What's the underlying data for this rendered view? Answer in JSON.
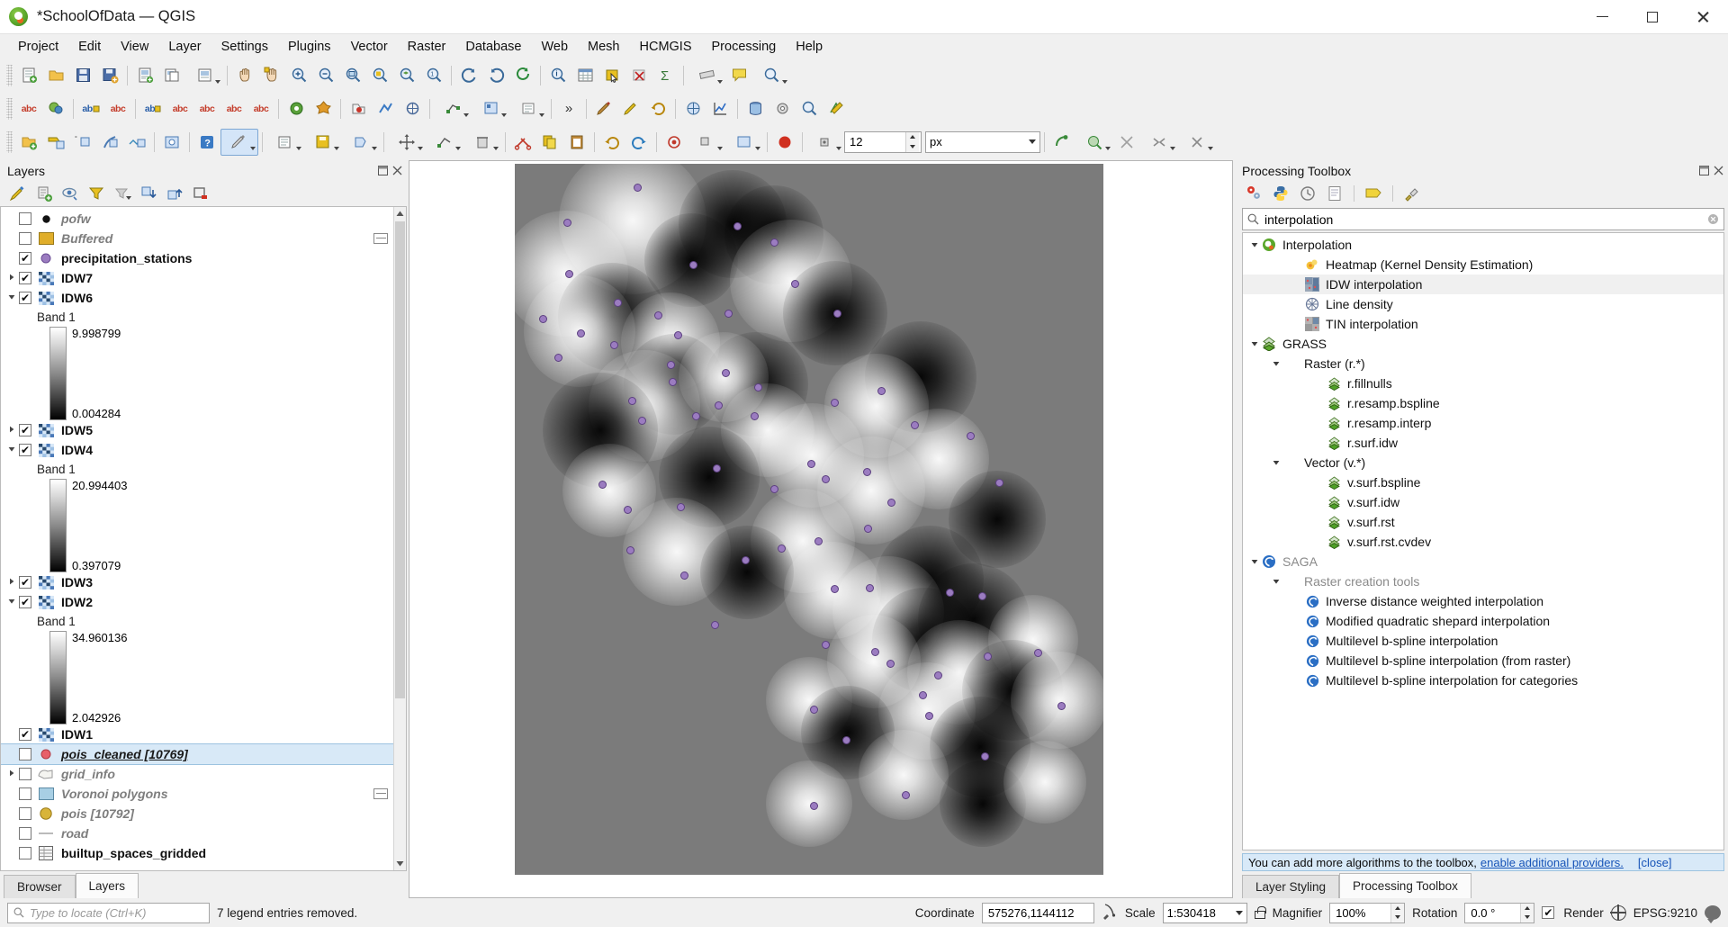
{
  "window": {
    "title": "*SchoolOfData — QGIS",
    "app_icon": "qgis-logo-icon",
    "minimize": "minimize-icon",
    "maximize": "maximize-icon",
    "close": "close-icon"
  },
  "menubar": {
    "items": [
      "Project",
      "Edit",
      "View",
      "Layer",
      "Settings",
      "Plugins",
      "Vector",
      "Raster",
      "Database",
      "Web",
      "Mesh",
      "HCMGIS",
      "Processing",
      "Help"
    ]
  },
  "toolbars": {
    "row1": [
      "new-project-icon",
      "open-project-icon",
      "save-project-icon",
      "save-as-icon",
      "new-print-layout-icon",
      "layout-manager-icon",
      "show-layouts-icon",
      "pan-map-icon",
      "pan-to-selection-icon",
      "zoom-in-icon",
      "zoom-out-icon",
      "zoom-full-icon",
      "zoom-selection-icon",
      "zoom-layer-icon",
      "zoom-native-icon",
      "zoom-last-icon",
      "zoom-next-icon",
      "refresh-icon",
      "identify-features-icon",
      "open-attribute-table-icon",
      "select-features-icon",
      "deselect-icon",
      "statistical-summary-icon",
      "measure-icon",
      "text-annotation-icon",
      "show-map-tips-icon",
      "bookmarks-icon"
    ],
    "row2": [
      "label-abc-icon",
      "style-manager-icon",
      "label-toggle-icon",
      "label-red-icon",
      "label-1-icon",
      "label-2-icon",
      "label-3-icon",
      "label-4-icon",
      "color-picker-icon",
      "temporal-controller-icon",
      "warning-icon",
      "add-feature-point-icon",
      "add-feature-line-icon",
      "add-feature-poly-icon",
      "vertex-tool-icon",
      "node-tool-icon",
      "modify-attributes-icon",
      "overflow-icon",
      "digitize-shape-icon",
      "trace-icon",
      "undo-edit-icon",
      "georeferencer-icon",
      "plot-icon",
      "db-manager-icon",
      "processing-icon",
      "python-console-icon",
      "plugin-manager-icon"
    ],
    "row3": [
      "new-shapefile-icon",
      "new-geopackage-icon",
      "new-spatialite-icon",
      "new-memory-layer-icon",
      "new-mesh-layer-icon",
      "new-gpx-icon",
      "help-contents-icon",
      "current-edits-icon",
      "toggle-editing-icon",
      "save-layer-edits-icon",
      "add-polygon-icon",
      "move-feature-icon",
      "vertex-tool-all-icon",
      "delete-selected-icon",
      "cut-features-icon",
      "copy-features-icon",
      "paste-features-icon",
      "undo-icon",
      "redo-icon",
      "rotate-point-symbols-icon",
      "offset-curve-icon",
      "reshape-features-icon",
      "split-features-icon",
      "merge-features-icon",
      "simplify-feature-icon",
      "add-ring-icon",
      "add-part-icon",
      "fill-ring-icon",
      "delete-ring-icon",
      "delete-part-icon",
      "rotate-feature-icon",
      "scale-feature-icon"
    ],
    "size_value": "12",
    "unit_value": "px"
  },
  "layers_panel": {
    "title": "Layers",
    "panel_buttons": [
      "float-panel-icon",
      "close-panel-icon"
    ],
    "toolbar_icons": [
      "open-layer-styling-icon",
      "add-group-icon",
      "manage-map-themes-icon",
      "filter-legend-icon",
      "filter-legend-expression-icon",
      "expand-all-icon",
      "collapse-all-icon",
      "remove-layer-icon"
    ],
    "items": [
      {
        "indent": 0,
        "expander": "",
        "checked": false,
        "symbol": "point-black",
        "label": "pofw",
        "style": "dim",
        "extra": ""
      },
      {
        "indent": 0,
        "expander": "",
        "checked": false,
        "symbol": "fill-gold",
        "label": "Buffered",
        "style": "dim",
        "extra": "edit"
      },
      {
        "indent": 0,
        "expander": "",
        "checked": true,
        "symbol": "point-purple",
        "label": "precipitation_stations",
        "style": "bold",
        "extra": ""
      },
      {
        "indent": 0,
        "expander": "collapsed",
        "checked": true,
        "symbol": "raster",
        "label": "IDW7",
        "style": "bold",
        "extra": ""
      },
      {
        "indent": 0,
        "expander": "expanded",
        "checked": true,
        "symbol": "raster",
        "label": "IDW6",
        "style": "bold",
        "extra": ""
      },
      {
        "type": "band",
        "label": "Band 1",
        "max": "9.998799",
        "min": "0.004284"
      },
      {
        "indent": 0,
        "expander": "collapsed",
        "checked": true,
        "symbol": "raster",
        "label": "IDW5",
        "style": "bold",
        "extra": ""
      },
      {
        "indent": 0,
        "expander": "expanded",
        "checked": true,
        "symbol": "raster",
        "label": "IDW4",
        "style": "bold",
        "extra": ""
      },
      {
        "type": "band",
        "label": "Band 1",
        "max": "20.994403",
        "min": "0.397079"
      },
      {
        "indent": 0,
        "expander": "collapsed",
        "checked": true,
        "symbol": "raster",
        "label": "IDW3",
        "style": "bold",
        "extra": ""
      },
      {
        "indent": 0,
        "expander": "expanded",
        "checked": true,
        "symbol": "raster",
        "label": "IDW2",
        "style": "bold",
        "extra": ""
      },
      {
        "type": "band",
        "label": "Band 1",
        "max": "34.960136",
        "min": "2.042926"
      },
      {
        "indent": 0,
        "expander": "",
        "checked": true,
        "symbol": "raster",
        "label": "IDW1",
        "style": "bold",
        "extra": ""
      },
      {
        "indent": 0,
        "expander": "",
        "checked": false,
        "symbol": "point-red",
        "label": "pois_cleaned [10769]",
        "style": "selected",
        "extra": ""
      },
      {
        "indent": 0,
        "expander": "collapsed",
        "checked": false,
        "symbol": "polygon-outline",
        "label": "grid_info",
        "style": "dim",
        "extra": ""
      },
      {
        "indent": 0,
        "expander": "",
        "checked": false,
        "symbol": "fill-lightblue",
        "label": "Voronoi polygons",
        "style": "dim",
        "extra": "edit"
      },
      {
        "indent": 0,
        "expander": "",
        "checked": false,
        "symbol": "point-gold",
        "label": "pois [10792]",
        "style": "dim",
        "extra": ""
      },
      {
        "indent": 0,
        "expander": "",
        "checked": false,
        "symbol": "line-grey",
        "label": "road",
        "style": "dim",
        "extra": ""
      },
      {
        "indent": 0,
        "expander": "",
        "checked": false,
        "symbol": "table",
        "label": "builtup_spaces_gridded",
        "style": "bold-plain",
        "extra": ""
      }
    ],
    "tabs": [
      {
        "label": "Browser",
        "active": false
      },
      {
        "label": "Layers",
        "active": true
      }
    ]
  },
  "processing_panel": {
    "title": "Processing Toolbox",
    "panel_buttons": [
      "float-panel-icon",
      "close-panel-icon"
    ],
    "toolbar_icons": [
      "run-model-icon",
      "python-script-icon",
      "history-icon",
      "results-viewer-icon",
      "models-icon",
      "options-icon"
    ],
    "search": {
      "value": "interpolation",
      "icon": "search-icon"
    },
    "tree": [
      {
        "depth": 0,
        "expander": "expanded",
        "icon": "qgis-provider-icon",
        "label": "Interpolation",
        "grey": false
      },
      {
        "depth": 2,
        "expander": "none",
        "icon": "heatmap-icon",
        "label": "Heatmap (Kernel Density Estimation)",
        "grey": false
      },
      {
        "depth": 2,
        "expander": "none",
        "icon": "idw-icon",
        "label": "IDW interpolation",
        "grey": false,
        "selected": true
      },
      {
        "depth": 2,
        "expander": "none",
        "icon": "linedensity-icon",
        "label": "Line density",
        "grey": false
      },
      {
        "depth": 2,
        "expander": "none",
        "icon": "tin-icon",
        "label": "TIN interpolation",
        "grey": false
      },
      {
        "depth": 0,
        "expander": "expanded",
        "icon": "grass-icon",
        "label": "GRASS",
        "grey": false
      },
      {
        "depth": 1,
        "expander": "expanded",
        "icon": "none",
        "label": "Raster (r.*)",
        "grey": false
      },
      {
        "depth": 3,
        "expander": "none",
        "icon": "grass-small-icon",
        "label": "r.fillnulls",
        "grey": false
      },
      {
        "depth": 3,
        "expander": "none",
        "icon": "grass-small-icon",
        "label": "r.resamp.bspline",
        "grey": false
      },
      {
        "depth": 3,
        "expander": "none",
        "icon": "grass-small-icon",
        "label": "r.resamp.interp",
        "grey": false
      },
      {
        "depth": 3,
        "expander": "none",
        "icon": "grass-small-icon",
        "label": "r.surf.idw",
        "grey": false
      },
      {
        "depth": 1,
        "expander": "expanded",
        "icon": "none",
        "label": "Vector (v.*)",
        "grey": false
      },
      {
        "depth": 3,
        "expander": "none",
        "icon": "grass-small-icon",
        "label": "v.surf.bspline",
        "grey": false
      },
      {
        "depth": 3,
        "expander": "none",
        "icon": "grass-small-icon",
        "label": "v.surf.idw",
        "grey": false
      },
      {
        "depth": 3,
        "expander": "none",
        "icon": "grass-small-icon",
        "label": "v.surf.rst",
        "grey": false
      },
      {
        "depth": 3,
        "expander": "none",
        "icon": "grass-small-icon",
        "label": "v.surf.rst.cvdev",
        "grey": false
      },
      {
        "depth": 0,
        "expander": "expanded",
        "icon": "saga-icon",
        "label": "SAGA",
        "grey": true
      },
      {
        "depth": 1,
        "expander": "expanded",
        "icon": "none",
        "label": "Raster creation tools",
        "grey": true
      },
      {
        "depth": 2,
        "expander": "none",
        "icon": "saga-small-icon",
        "label": "Inverse distance weighted interpolation",
        "grey": false
      },
      {
        "depth": 2,
        "expander": "none",
        "icon": "saga-small-icon",
        "label": "Modified quadratic shepard interpolation",
        "grey": false
      },
      {
        "depth": 2,
        "expander": "none",
        "icon": "saga-small-icon",
        "label": "Multilevel b-spline interpolation",
        "grey": false
      },
      {
        "depth": 2,
        "expander": "none",
        "icon": "saga-small-icon",
        "label": "Multilevel b-spline interpolation (from raster)",
        "grey": false
      },
      {
        "depth": 2,
        "expander": "none",
        "icon": "saga-small-icon",
        "label": "Multilevel b-spline interpolation for categories",
        "grey": false
      }
    ],
    "notice": {
      "text": "You can add more algorithms to the toolbox,",
      "link": "enable additional providers.",
      "close": "[close]"
    },
    "tabs": [
      {
        "label": "Layer Styling",
        "active": false
      },
      {
        "label": "Processing Toolbox",
        "active": true
      }
    ]
  },
  "statusbar": {
    "locator_placeholder": "Type to locate (Ctrl+K)",
    "message": "7 legend entries removed.",
    "coordinate_label": "Coordinate",
    "coordinate_value": "575276,1144112",
    "coordinate_toggle_icon": "coordinate-capture-icon",
    "scale_label": "Scale",
    "scale_value": "1:530418",
    "lock_icon": "lock-scale-icon",
    "magnifier_label": "Magnifier",
    "magnifier_value": "100%",
    "rotation_label": "Rotation",
    "rotation_value": "0.0 °",
    "render_label": "Render",
    "render_checked": true,
    "crs_label": "EPSG:9210",
    "crs_icon": "globe-icon",
    "messages_icon": "messages-icon"
  },
  "map": {
    "points_count": 63,
    "background": "#ffffff"
  }
}
